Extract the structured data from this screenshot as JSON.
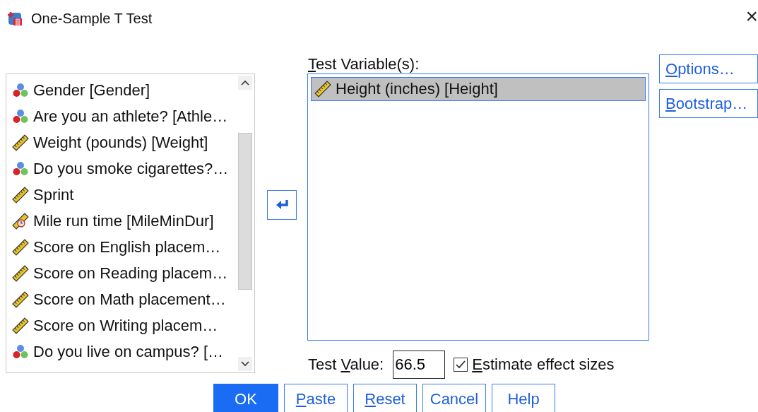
{
  "window": {
    "title": "One-Sample T Test",
    "close": "×"
  },
  "variables": [
    {
      "kind": "nominal",
      "label": "Gender [Gender]"
    },
    {
      "kind": "nominal",
      "label": "Are you an athlete? [Athle…"
    },
    {
      "kind": "scale",
      "label": "Weight (pounds) [Weight]"
    },
    {
      "kind": "nominal",
      "label": "Do you smoke cigarettes?…"
    },
    {
      "kind": "scale",
      "label": "Sprint"
    },
    {
      "kind": "time",
      "label": "Mile run time [MileMinDur]"
    },
    {
      "kind": "scale",
      "label": "Score on English placem…"
    },
    {
      "kind": "scale",
      "label": "Score on Reading placem…"
    },
    {
      "kind": "scale",
      "label": "Score on Math placement…"
    },
    {
      "kind": "scale",
      "label": "Score on Writing placem…"
    },
    {
      "kind": "nominal",
      "label": "Do you live on campus? […"
    }
  ],
  "test_variables": {
    "heading": {
      "mnemonic": "T",
      "after": "est Variable(s):"
    },
    "items": [
      {
        "kind": "scale",
        "label": "Height (inches) [Height]",
        "selected": true
      }
    ]
  },
  "side_buttons": [
    {
      "mnemonic": "O",
      "after": "ptions…"
    },
    {
      "mnemonic": "B",
      "after": "ootstrap…"
    }
  ],
  "test_value": {
    "label": {
      "before": "Test ",
      "mnemonic": "V",
      "after": "alue:"
    },
    "value": "66.5"
  },
  "effect_sizes": {
    "label": {
      "mnemonic": "E",
      "after": "stimate effect sizes"
    },
    "checked": true
  },
  "buttons": [
    {
      "kind": "primary",
      "text": {
        "label": "OK"
      }
    },
    {
      "kind": "normal",
      "text": {
        "mnemonic": "P",
        "after": "aste"
      }
    },
    {
      "kind": "normal",
      "text": {
        "mnemonic": "R",
        "after": "eset"
      }
    },
    {
      "kind": "normal",
      "text": {
        "label": "Cancel"
      }
    },
    {
      "kind": "normal",
      "text": {
        "label": "Help"
      }
    }
  ]
}
